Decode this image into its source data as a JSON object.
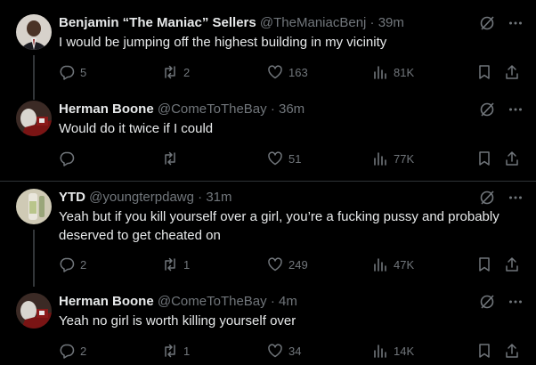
{
  "tweets": [
    {
      "name": "Benjamin “The Maniac” Sellers",
      "handle": "@TheManiacBenj",
      "dot": "·",
      "time": "39m",
      "text": "I would be jumping off the highest building in my vicinity",
      "replies": "5",
      "reposts": "2",
      "likes": "163",
      "views": "81K"
    },
    {
      "name": "Herman Boone",
      "handle": "@ComeToTheBay",
      "dot": "·",
      "time": "36m",
      "text": "Would do it twice if I could",
      "replies": "",
      "reposts": "",
      "likes": "51",
      "views": "77K"
    },
    {
      "name": "YTD",
      "handle": "@youngterpdawg",
      "dot": "·",
      "time": "31m",
      "text": "Yeah but if you kill yourself over a girl, you’re a fucking pussy and probably deserved to get cheated on",
      "replies": "2",
      "reposts": "1",
      "likes": "249",
      "views": "47K"
    },
    {
      "name": "Herman Boone",
      "handle": "@ComeToTheBay",
      "dot": "·",
      "time": "4m",
      "text": "Yeah no girl is worth killing yourself over",
      "replies": "2",
      "reposts": "1",
      "likes": "34",
      "views": "14K"
    }
  ],
  "colors": {
    "background": "#000000",
    "text": "#e7e9ea",
    "muted": "#71767b",
    "divider": "#2f3336"
  }
}
